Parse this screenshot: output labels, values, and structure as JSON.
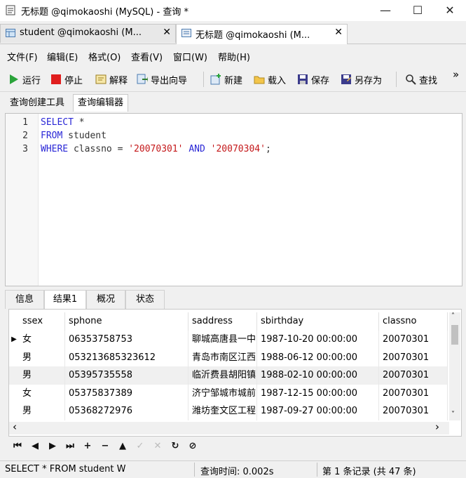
{
  "window": {
    "title": "无标题 @qimokaoshi (MySQL) - 查询 *",
    "minimize": "—",
    "maximize": "☐",
    "close": "✕"
  },
  "doc_tabs": [
    {
      "label": "student @qimokaoshi (M...",
      "close": "✕"
    },
    {
      "label": "无标题 @qimokaoshi (M...",
      "close": "✕"
    }
  ],
  "menu": [
    "文件(F)",
    "编辑(E)",
    "格式(O)",
    "查看(V)",
    "窗口(W)",
    "帮助(H)"
  ],
  "toolbar": {
    "run": "运行",
    "stop": "停止",
    "explain": "解释",
    "export_wizard": "导出向导",
    "new": "新建",
    "load": "载入",
    "save": "保存",
    "save_as": "另存为",
    "find": "查找",
    "more": "»"
  },
  "sub_tabs": [
    "查询创建工具",
    "查询编辑器"
  ],
  "editor": {
    "line_numbers": [
      "1",
      "2",
      "3"
    ],
    "lines": [
      [
        {
          "t": "SELECT",
          "k": "kw"
        },
        {
          "t": " *",
          "k": "plain"
        }
      ],
      [
        {
          "t": "FROM",
          "k": "kw"
        },
        {
          "t": " student",
          "k": "plain"
        }
      ],
      [
        {
          "t": "WHERE",
          "k": "kw"
        },
        {
          "t": " classno = ",
          "k": "plain"
        },
        {
          "t": "'20070301'",
          "k": "str"
        },
        {
          "t": " ",
          "k": "plain"
        },
        {
          "t": "AND",
          "k": "kw"
        },
        {
          "t": " ",
          "k": "plain"
        },
        {
          "t": "'20070304'",
          "k": "str"
        },
        {
          "t": ";",
          "k": "plain"
        }
      ]
    ]
  },
  "result_tabs": [
    "信息",
    "结果1",
    "概况",
    "状态"
  ],
  "grid": {
    "row_marker": "▶",
    "columns": [
      "ssex",
      "sphone",
      "saddress",
      "sbirthday",
      "classno"
    ],
    "rows": [
      [
        "女",
        "06353758753",
        "聊城高唐县一中",
        "1987-10-20 00:00:00",
        "20070301"
      ],
      [
        "男",
        "053213685323612",
        "青岛市南区江西",
        "1988-06-12 00:00:00",
        "20070301"
      ],
      [
        "男",
        "05395735558",
        "临沂费县胡阳镇",
        "1988-02-10 00:00:00",
        "20070301"
      ],
      [
        "女",
        "05375837389",
        "济宁邹城市城前",
        "1987-12-15 00:00:00",
        "20070301"
      ],
      [
        "男",
        "05368272976",
        "潍坊奎文区工程",
        "1987-09-27 00:00:00",
        "20070301"
      ]
    ],
    "scroll_left": "‹",
    "scroll_right": "›",
    "scroll_up": "˄",
    "scroll_down": "˅"
  },
  "nav": {
    "first": "⏮",
    "prev": "◀",
    "next": "▶",
    "last": "⏭",
    "add": "+",
    "delete": "−",
    "up": "▲",
    "apply": "✓",
    "discard": "✕",
    "refresh": "↻",
    "stop": "⊘"
  },
  "status": {
    "sql": "SELECT * FROM student W",
    "query_time": "查询时间: 0.002s",
    "record": "第 1 条记录 (共 47 条)"
  },
  "colors": {
    "keyword": "#2a27d6",
    "string": "#c4181a",
    "run_icon": "#2aa33a",
    "stop_icon": "#e01e1e"
  }
}
